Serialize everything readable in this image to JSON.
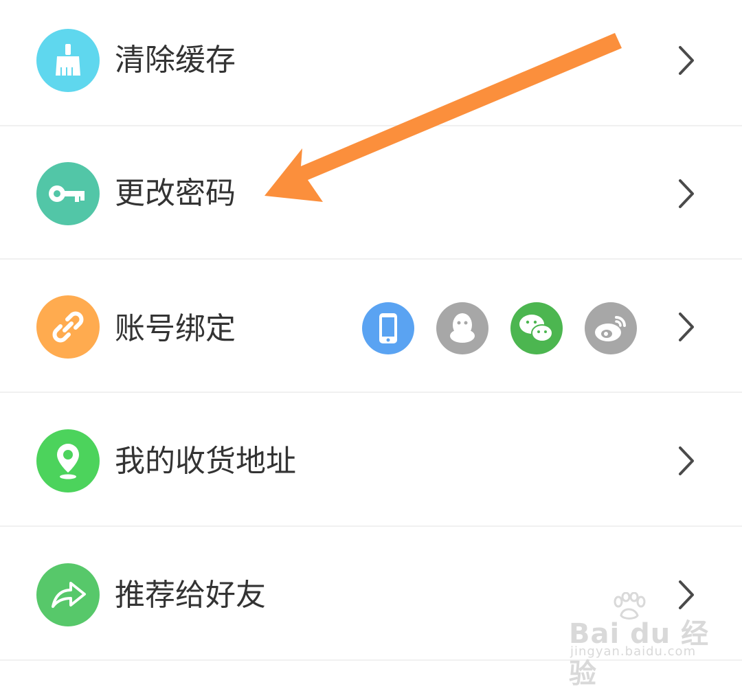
{
  "settings": {
    "items": [
      {
        "label": "清除缓存",
        "icon": "broom-icon",
        "color": "#5fd7ee"
      },
      {
        "label": "更改密码",
        "icon": "key-icon",
        "color": "#52c6a7"
      },
      {
        "label": "账号绑定",
        "icon": "link-icon",
        "color": "#ffab4f"
      },
      {
        "label": "我的收货地址",
        "icon": "location-pin-icon",
        "color": "#4cd35c"
      },
      {
        "label": "推荐给好友",
        "icon": "share-icon",
        "color": "#57c86a"
      }
    ],
    "bind_accounts": [
      {
        "icon": "phone-icon",
        "color": "#5aa3f2"
      },
      {
        "icon": "qq-icon",
        "color": "#a7a7a7"
      },
      {
        "icon": "wechat-icon",
        "color": "#4cb650"
      },
      {
        "icon": "weibo-icon",
        "color": "#a7a7a7"
      }
    ]
  },
  "annotation": {
    "arrow_color": "#fb8f3c"
  },
  "watermark": {
    "logo": "Bai du 经验",
    "url": "jingyan.baidu.com"
  }
}
